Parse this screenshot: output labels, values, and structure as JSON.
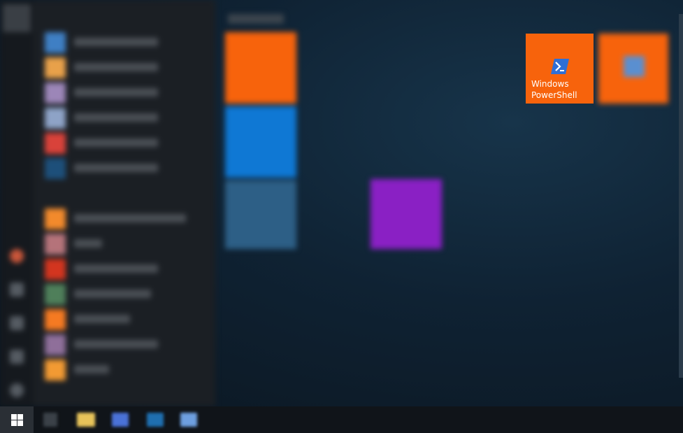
{
  "start_menu": {
    "powershell_tile": {
      "label_line1": "Windows",
      "label_line2": "PowerShell",
      "icon": "powershell-icon",
      "color": "#f7630c"
    }
  },
  "taskbar": {
    "start_button": {
      "icon": "windows-logo-icon"
    },
    "pinned": [
      {
        "icon": "task-view-icon"
      },
      {
        "icon": "file-explorer-icon"
      },
      {
        "icon": "app-icon-blue"
      },
      {
        "icon": "vscode-icon"
      },
      {
        "icon": "app-icon-light-blue"
      }
    ]
  },
  "colors": {
    "accent_orange": "#f7630c",
    "taskbar": "#101419",
    "start_button": "#2a2f35"
  }
}
